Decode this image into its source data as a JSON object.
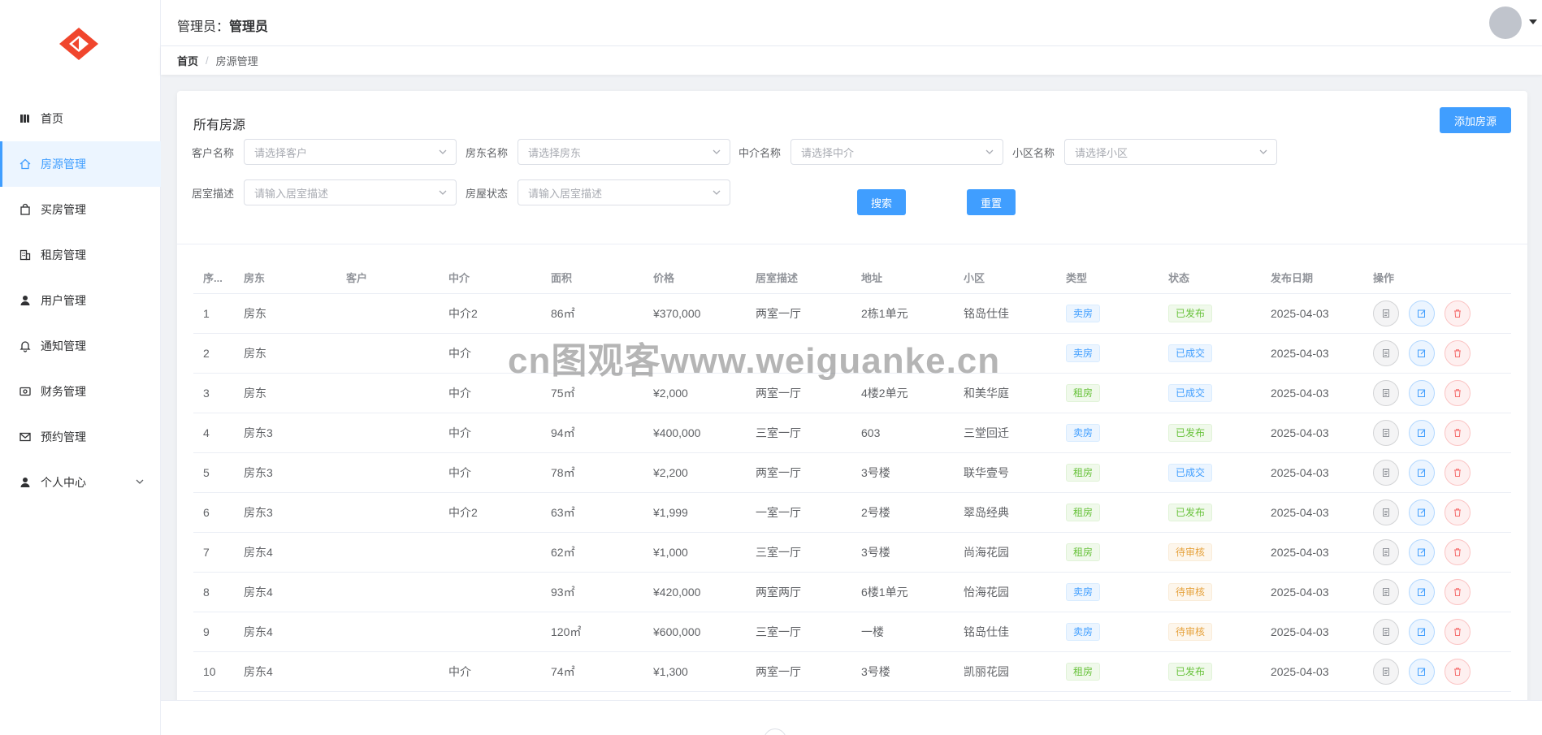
{
  "sidebar": {
    "menu": [
      {
        "label": "首页",
        "icon": "book-icon",
        "active": false
      },
      {
        "label": "房源管理",
        "icon": "house-icon",
        "active": true
      },
      {
        "label": "买房管理",
        "icon": "shopping-bag-icon",
        "active": false
      },
      {
        "label": "租房管理",
        "icon": "building-icon",
        "active": false
      },
      {
        "label": "用户管理",
        "icon": "user-icon",
        "active": false
      },
      {
        "label": "通知管理",
        "icon": "bell-icon",
        "active": false
      },
      {
        "label": "财务管理",
        "icon": "wallet-icon",
        "active": false
      },
      {
        "label": "预约管理",
        "icon": "mail-icon",
        "active": false
      },
      {
        "label": "个人中心",
        "icon": "user-icon",
        "active": false,
        "has_submenu": true
      }
    ]
  },
  "header": {
    "admin_prefix": "管理员：",
    "admin_name": "管理员"
  },
  "breadcrumb": {
    "home": "首页",
    "separator": "/",
    "current": "房源管理"
  },
  "card": {
    "title": "所有房源",
    "add_button": "添加房源"
  },
  "filters": {
    "customer": {
      "label": "客户名称",
      "placeholder": "请选择客户"
    },
    "landlord": {
      "label": "房东名称",
      "placeholder": "请选择房东"
    },
    "agent": {
      "label": "中介名称",
      "placeholder": "请选择中介"
    },
    "community": {
      "label": "小区名称",
      "placeholder": "请选择小区"
    },
    "room_desc": {
      "label": "居室描述",
      "placeholder": "请输入居室描述"
    },
    "status": {
      "label": "房屋状态",
      "placeholder": "请输入居室描述"
    },
    "search_button": "搜索",
    "reset_button": "重置"
  },
  "table": {
    "columns": [
      "序...",
      "房东",
      "客户",
      "中介",
      "面积",
      "价格",
      "居室描述",
      "地址",
      "小区",
      "类型",
      "状态",
      "发布日期",
      "操作"
    ],
    "rows": [
      {
        "no": "1",
        "landlord": "房东",
        "customer": "",
        "agent": "中介2",
        "area": "86㎡",
        "price": "¥370,000",
        "rooms": "两室一厅",
        "address": "2栋1单元",
        "community": "铭岛仕佳",
        "type": "卖房",
        "status": "已发布",
        "date": "2025-04-03"
      },
      {
        "no": "2",
        "landlord": "房东",
        "customer": "",
        "agent": "中介",
        "area": "",
        "price": "",
        "rooms": "",
        "address": "",
        "community": "",
        "type": "卖房",
        "status": "已成交",
        "date": "2025-04-03"
      },
      {
        "no": "3",
        "landlord": "房东",
        "customer": "",
        "agent": "中介",
        "area": "75㎡",
        "price": "¥2,000",
        "rooms": "两室一厅",
        "address": "4楼2单元",
        "community": "和美华庭",
        "type": "租房",
        "status": "已成交",
        "date": "2025-04-03"
      },
      {
        "no": "4",
        "landlord": "房东3",
        "customer": "",
        "agent": "中介",
        "area": "94㎡",
        "price": "¥400,000",
        "rooms": "三室一厅",
        "address": "603",
        "community": "三堂回迁",
        "type": "卖房",
        "status": "已发布",
        "date": "2025-04-03"
      },
      {
        "no": "5",
        "landlord": "房东3",
        "customer": "",
        "agent": "中介",
        "area": "78㎡",
        "price": "¥2,200",
        "rooms": "两室一厅",
        "address": "3号楼",
        "community": "联华壹号",
        "type": "租房",
        "status": "已成交",
        "date": "2025-04-03"
      },
      {
        "no": "6",
        "landlord": "房东3",
        "customer": "",
        "agent": "中介2",
        "area": "63㎡",
        "price": "¥1,999",
        "rooms": "一室一厅",
        "address": "2号楼",
        "community": "翠岛经典",
        "type": "租房",
        "status": "已发布",
        "date": "2025-04-03"
      },
      {
        "no": "7",
        "landlord": "房东4",
        "customer": "",
        "agent": "",
        "area": "62㎡",
        "price": "¥1,000",
        "rooms": "三室一厅",
        "address": "3号楼",
        "community": "尚海花园",
        "type": "租房",
        "status": "待审核",
        "date": "2025-04-03"
      },
      {
        "no": "8",
        "landlord": "房东4",
        "customer": "",
        "agent": "",
        "area": "93㎡",
        "price": "¥420,000",
        "rooms": "两室两厅",
        "address": "6楼1单元",
        "community": "怡海花园",
        "type": "卖房",
        "status": "待审核",
        "date": "2025-04-03"
      },
      {
        "no": "9",
        "landlord": "房东4",
        "customer": "",
        "agent": "",
        "area": "120㎡",
        "price": "¥600,000",
        "rooms": "三室一厅",
        "address": "一楼",
        "community": "铭岛仕佳",
        "type": "卖房",
        "status": "待审核",
        "date": "2025-04-03"
      },
      {
        "no": "10",
        "landlord": "房东4",
        "customer": "",
        "agent": "中介",
        "area": "74㎡",
        "price": "¥1,300",
        "rooms": "两室一厅",
        "address": "3号楼",
        "community": "凯丽花园",
        "type": "租房",
        "status": "已发布",
        "date": "2025-04-03"
      }
    ]
  },
  "watermark": "cn图观客www.weiguanke.cn",
  "colors": {
    "primary": "#409eff",
    "success": "#67c23a",
    "warning": "#e6a23c",
    "danger": "#f56c6c",
    "logo": "#f0462d"
  }
}
